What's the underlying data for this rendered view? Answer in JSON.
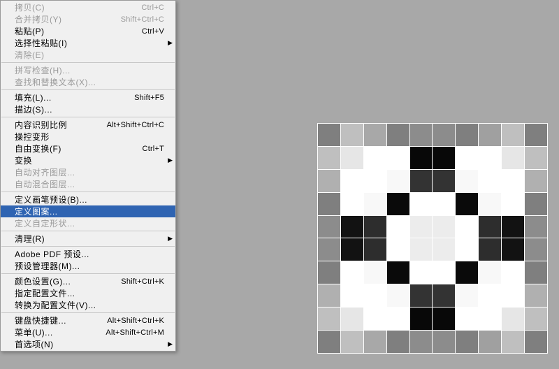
{
  "menu": {
    "items": [
      {
        "label": "拷贝(C)",
        "shortcut": "Ctrl+C",
        "disabled": true
      },
      {
        "label": "合并拷贝(Y)",
        "shortcut": "Shift+Ctrl+C",
        "disabled": true
      },
      {
        "label": "粘贴(P)",
        "shortcut": "Ctrl+V",
        "disabled": false
      },
      {
        "label": "选择性粘贴(I)",
        "shortcut": "",
        "disabled": false,
        "submenu": true
      },
      {
        "label": "清除(E)",
        "shortcut": "",
        "disabled": true
      },
      {
        "type": "sep"
      },
      {
        "label": "拼写检查(H)...",
        "shortcut": "",
        "disabled": true
      },
      {
        "label": "查找和替换文本(X)...",
        "shortcut": "",
        "disabled": true
      },
      {
        "type": "sep"
      },
      {
        "label": "填充(L)...",
        "shortcut": "Shift+F5",
        "disabled": false
      },
      {
        "label": "描边(S)...",
        "shortcut": "",
        "disabled": false
      },
      {
        "type": "sep"
      },
      {
        "label": "内容识别比例",
        "shortcut": "Alt+Shift+Ctrl+C",
        "disabled": false
      },
      {
        "label": "操控变形",
        "shortcut": "",
        "disabled": false
      },
      {
        "label": "自由变换(F)",
        "shortcut": "Ctrl+T",
        "disabled": false
      },
      {
        "label": "变换",
        "shortcut": "",
        "disabled": false,
        "submenu": true
      },
      {
        "label": "自动对齐图层...",
        "shortcut": "",
        "disabled": true
      },
      {
        "label": "自动混合图层...",
        "shortcut": "",
        "disabled": true
      },
      {
        "type": "sep"
      },
      {
        "label": "定义画笔预设(B)...",
        "shortcut": "",
        "disabled": false
      },
      {
        "label": "定义图案...",
        "shortcut": "",
        "disabled": false,
        "highlighted": true
      },
      {
        "label": "定义自定形状...",
        "shortcut": "",
        "disabled": true
      },
      {
        "type": "sep"
      },
      {
        "label": "清理(R)",
        "shortcut": "",
        "disabled": false,
        "submenu": true
      },
      {
        "type": "sep"
      },
      {
        "label": "Adobe PDF 预设...",
        "shortcut": "",
        "disabled": false
      },
      {
        "label": "预设管理器(M)...",
        "shortcut": "",
        "disabled": false
      },
      {
        "type": "sep"
      },
      {
        "label": "颜色设置(G)...",
        "shortcut": "Shift+Ctrl+K",
        "disabled": false
      },
      {
        "label": "指定配置文件...",
        "shortcut": "",
        "disabled": false
      },
      {
        "label": "转换为配置文件(V)...",
        "shortcut": "",
        "disabled": false
      },
      {
        "type": "sep"
      },
      {
        "label": "键盘快捷键...",
        "shortcut": "Alt+Shift+Ctrl+K",
        "disabled": false
      },
      {
        "label": "菜单(U)...",
        "shortcut": "Alt+Shift+Ctrl+M",
        "disabled": false
      },
      {
        "label": "首选项(N)",
        "shortcut": "",
        "disabled": false,
        "submenu": true
      }
    ]
  },
  "pattern": {
    "grid": [
      [
        "#7f7f7f",
        "#bfbfbf",
        "#a8a8a8",
        "#7f7f7f",
        "#8c8c8c",
        "#8c8c8c",
        "#7f7f7f",
        "#a0a0a0",
        "#bfbfbf",
        "#7f7f7f"
      ],
      [
        "#bfbfbf",
        "#e6e6e6",
        "#ffffff",
        "#ffffff",
        "#080808",
        "#080808",
        "#ffffff",
        "#ffffff",
        "#e6e6e6",
        "#bfbfbf"
      ],
      [
        "#b0b0b0",
        "#ffffff",
        "#ffffff",
        "#f8f8f8",
        "#333333",
        "#333333",
        "#f8f8f8",
        "#ffffff",
        "#ffffff",
        "#b0b0b0"
      ],
      [
        "#7f7f7f",
        "#ffffff",
        "#f8f8f8",
        "#0a0a0a",
        "#ffffff",
        "#ffffff",
        "#0a0a0a",
        "#f8f8f8",
        "#ffffff",
        "#7f7f7f"
      ],
      [
        "#8c8c8c",
        "#121212",
        "#2d2d2d",
        "#ffffff",
        "#ececec",
        "#ececec",
        "#ffffff",
        "#2d2d2d",
        "#121212",
        "#8c8c8c"
      ],
      [
        "#8c8c8c",
        "#121212",
        "#2d2d2d",
        "#ffffff",
        "#ececec",
        "#ececec",
        "#ffffff",
        "#2d2d2d",
        "#121212",
        "#8c8c8c"
      ],
      [
        "#7f7f7f",
        "#ffffff",
        "#f8f8f8",
        "#0a0a0a",
        "#ffffff",
        "#ffffff",
        "#0a0a0a",
        "#f8f8f8",
        "#ffffff",
        "#7f7f7f"
      ],
      [
        "#b0b0b0",
        "#ffffff",
        "#ffffff",
        "#f8f8f8",
        "#333333",
        "#333333",
        "#f8f8f8",
        "#ffffff",
        "#ffffff",
        "#b0b0b0"
      ],
      [
        "#bfbfbf",
        "#e6e6e6",
        "#ffffff",
        "#ffffff",
        "#080808",
        "#080808",
        "#ffffff",
        "#ffffff",
        "#e6e6e6",
        "#bfbfbf"
      ],
      [
        "#7f7f7f",
        "#bfbfbf",
        "#a8a8a8",
        "#7f7f7f",
        "#8c8c8c",
        "#8c8c8c",
        "#7f7f7f",
        "#a0a0a0",
        "#bfbfbf",
        "#7f7f7f"
      ]
    ]
  }
}
